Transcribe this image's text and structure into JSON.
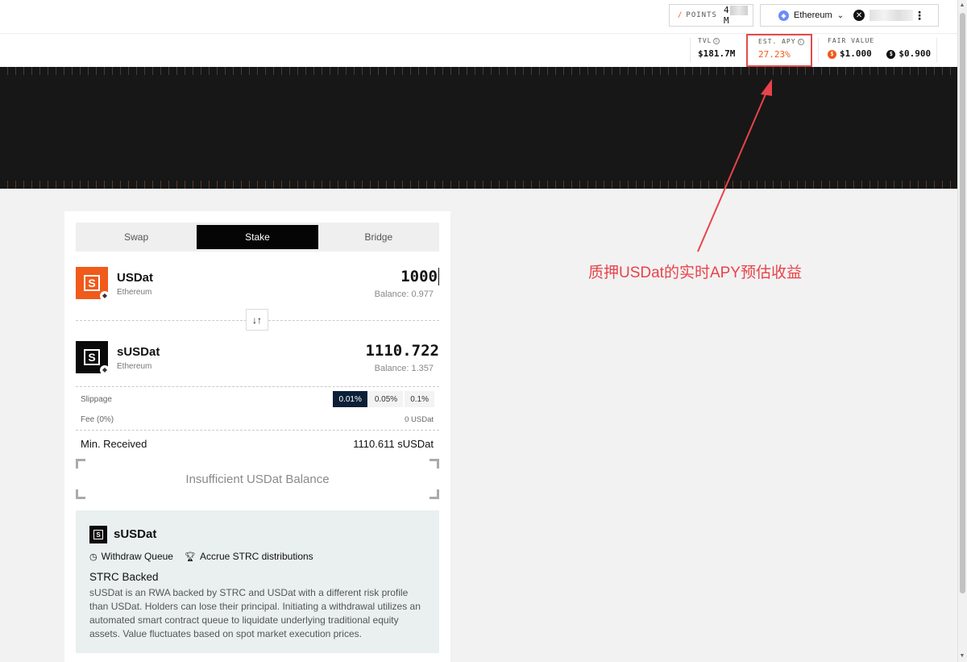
{
  "topbar": {
    "points_label": "POINTS",
    "points_value_prefix": "4",
    "points_value_suffix": "M",
    "network": "Ethereum"
  },
  "stats": {
    "tvl_label": "TVL",
    "tvl_value": "$181.7M",
    "apy_label": "EST. APY",
    "apy_value": "27.23%",
    "fv_label": "FAIR VALUE",
    "fv_usdat": "$1.000",
    "fv_susdat": "$0.900"
  },
  "tabs": [
    {
      "label": "Swap",
      "active": false
    },
    {
      "label": "Stake",
      "active": true
    },
    {
      "label": "Bridge",
      "active": false
    }
  ],
  "from_token": {
    "symbol": "USDat",
    "chain": "Ethereum",
    "amount": "1000",
    "balance": "Balance: 0.977"
  },
  "to_token": {
    "symbol": "sUSDat",
    "chain": "Ethereum",
    "amount": "1110.722",
    "balance": "Balance: 1.357"
  },
  "details": {
    "slippage_label": "Slippage",
    "slippage_options": [
      "0.01%",
      "0.05%",
      "0.1%"
    ],
    "slippage_selected": "0.01%",
    "fee_label": "Fee (0%)",
    "fee_value": "0 USDat",
    "min_received_label": "Min. Received",
    "min_received_value": "1110.611 sUSDat"
  },
  "cta_label": "Insufficient USDat Balance",
  "info": {
    "title": "sUSDat",
    "feature_1": "Withdraw Queue",
    "feature_2": "Accrue STRC distributions",
    "heading": "STRC Backed",
    "description": "sUSDat is an RWA backed by STRC and USDat with a different risk profile than USDat. Holders can lose their principal. Initiating a withdrawal utilizes an automated smart contract queue to liquidate underlying traditional equity assets. Value fluctuates based on spot market execution prices."
  },
  "annotation": {
    "text": "质押USDat的实时APY预估收益",
    "color": "#e8434a"
  },
  "colors": {
    "accent_orange": "#f05a1a",
    "annotation_red": "#e24b4b",
    "selected_slippage": "#0b2036"
  }
}
